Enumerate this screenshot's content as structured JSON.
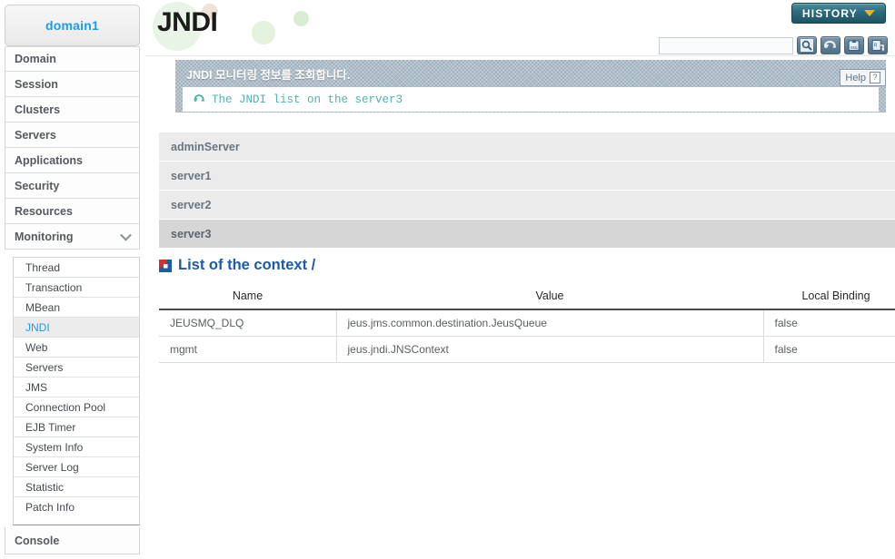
{
  "sidebar": {
    "domain_label": "domain1",
    "top_items": [
      {
        "label": "Domain"
      },
      {
        "label": "Session"
      },
      {
        "label": "Clusters"
      },
      {
        "label": "Servers"
      },
      {
        "label": "Applications"
      },
      {
        "label": "Security"
      },
      {
        "label": "Resources"
      },
      {
        "label": "Monitoring",
        "expanded": true,
        "icon": "chevron-down-icon"
      }
    ],
    "sub_items": [
      {
        "label": "Thread"
      },
      {
        "label": "Transaction"
      },
      {
        "label": "MBean"
      },
      {
        "label": "JNDI",
        "active": true
      },
      {
        "label": "Web"
      },
      {
        "label": "Servers"
      },
      {
        "label": "JMS"
      },
      {
        "label": "Connection Pool"
      },
      {
        "label": "EJB Timer"
      },
      {
        "label": "System Info"
      },
      {
        "label": "Server Log"
      },
      {
        "label": "Statistic"
      },
      {
        "label": "Patch Info"
      }
    ],
    "console_label": "Console",
    "accent_color": "#1b9cf0"
  },
  "header": {
    "logo_text": "JNDI",
    "history_label": "HISTORY",
    "history_icon": "chevron-down-icon",
    "history_color": "#2d6b7c",
    "history_chevron_color": "#f3b21c",
    "search_value": "",
    "search_placeholder": "",
    "tools": [
      {
        "name": "search-icon"
      },
      {
        "name": "refresh-icon"
      },
      {
        "name": "xml-export-icon"
      },
      {
        "name": "report-export-icon"
      }
    ]
  },
  "info_panel": {
    "title": "JNDI 모니터링 정보를 조회합니다.",
    "status_icon": "refresh-icon",
    "status_text": "The JNDI list on the server3",
    "status_color": "#4fb3ad",
    "help_label": "Help",
    "help_icon": "question-icon"
  },
  "servers": [
    {
      "label": "adminServer",
      "selected": false
    },
    {
      "label": "server1",
      "selected": false
    },
    {
      "label": "server2",
      "selected": false
    },
    {
      "label": "server3",
      "selected": true
    }
  ],
  "section": {
    "icon": "square-marker-icon",
    "title": "List of the context /",
    "title_color": "#1c5ba8"
  },
  "table": {
    "columns": [
      "Name",
      "Value",
      "Local Binding"
    ],
    "rows": [
      [
        "JEUSMQ_DLQ",
        "jeus.jms.common.destination.JeusQueue",
        "false"
      ],
      [
        "mgmt",
        "jeus.jndi.JNSContext",
        "false"
      ]
    ]
  }
}
